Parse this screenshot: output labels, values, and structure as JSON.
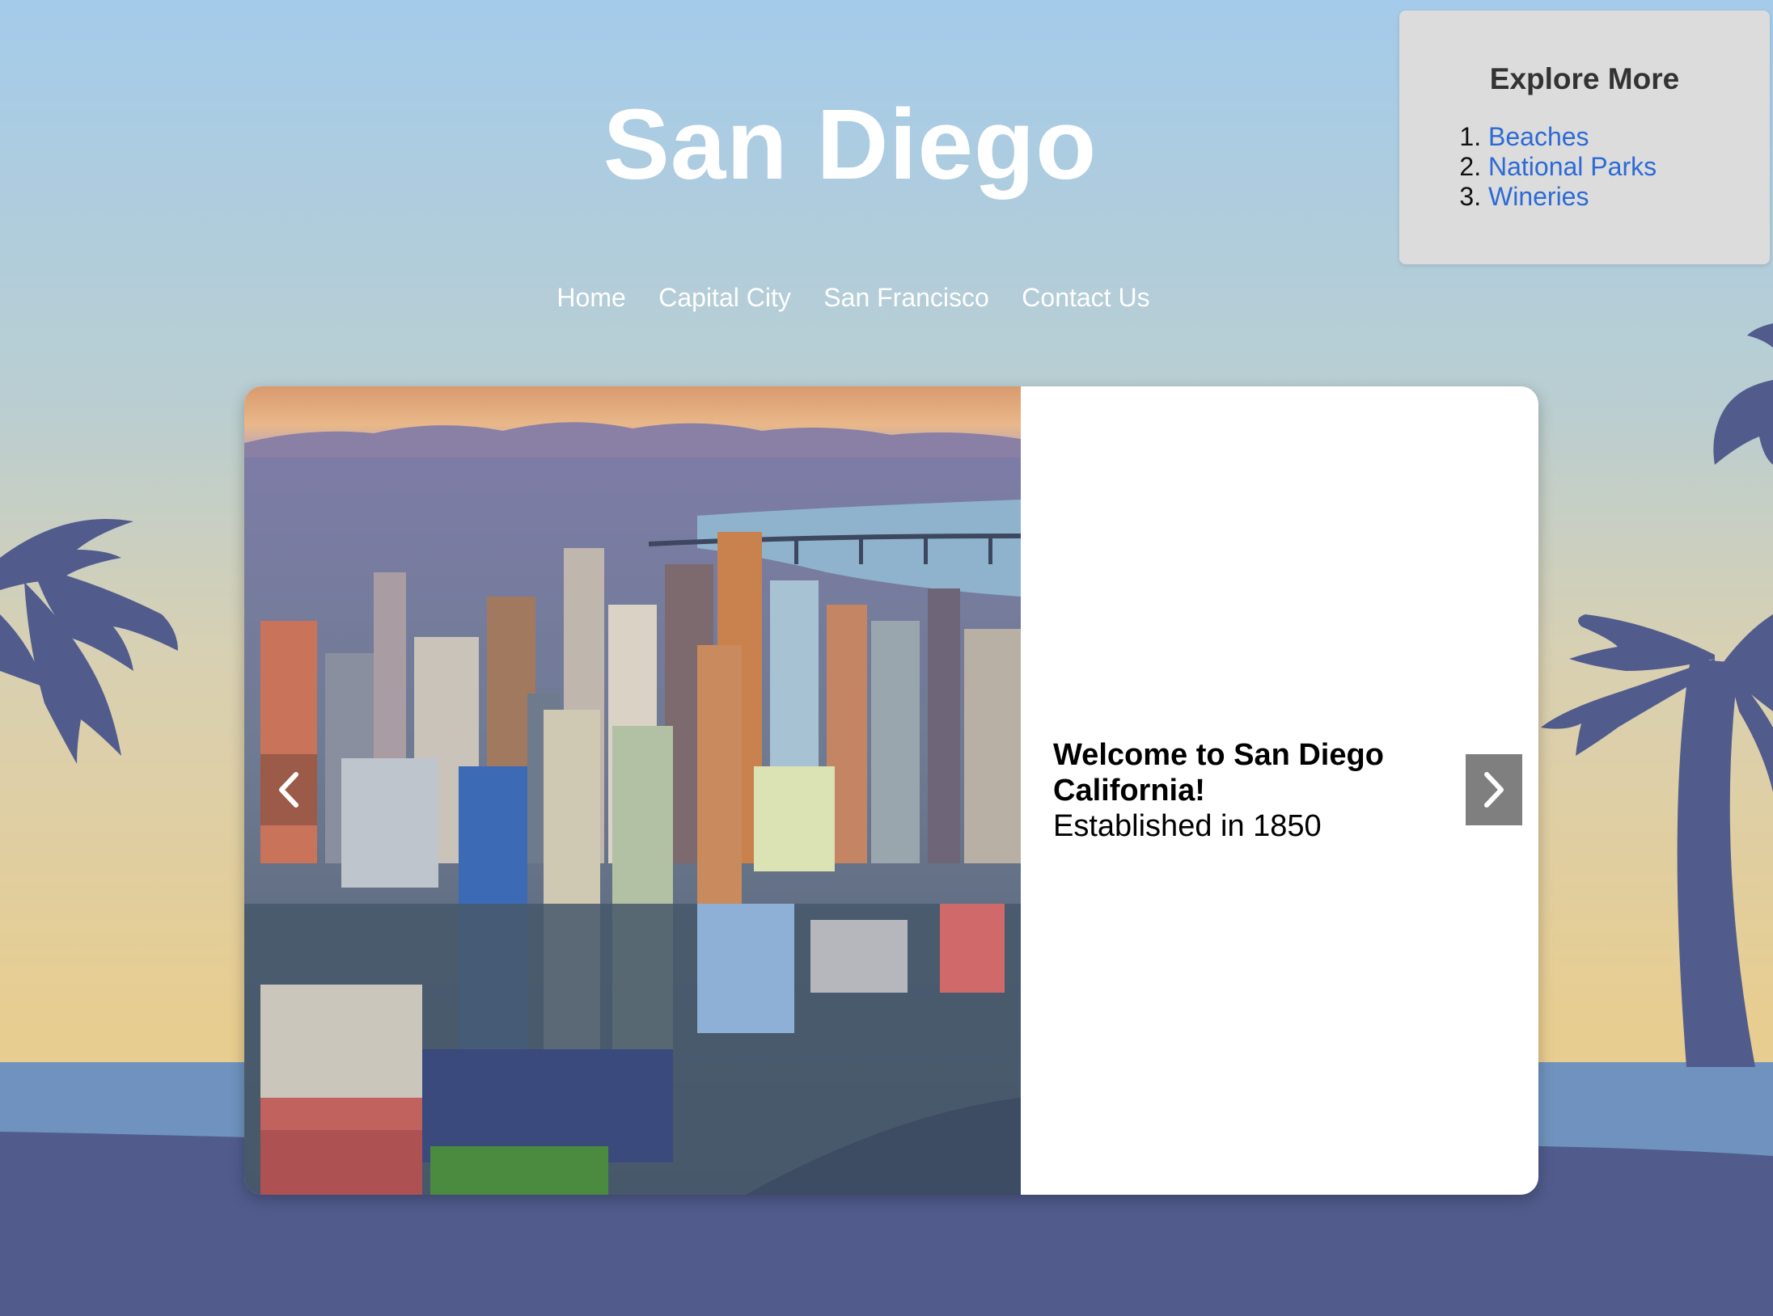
{
  "page": {
    "title": "San Diego"
  },
  "nav": {
    "items": [
      {
        "label": "Home"
      },
      {
        "label": "Capital City"
      },
      {
        "label": "San Francisco"
      },
      {
        "label": "Contact Us"
      }
    ]
  },
  "explore": {
    "title": "Explore More",
    "links": [
      {
        "label": "Beaches"
      },
      {
        "label": "National Parks"
      },
      {
        "label": "Wineries"
      }
    ]
  },
  "slide": {
    "heading": "Welcome to San Diego California!",
    "subheading": "Established in 1850",
    "prev_icon": "chevron-left-icon",
    "next_icon": "chevron-right-icon"
  },
  "colors": {
    "sky_top": "#a4cbea",
    "sand": "#e8cd90",
    "sea": "#6f93be",
    "palm": "#515c8d",
    "link": "#2c6ad6",
    "panel": "#dcdcdc"
  }
}
